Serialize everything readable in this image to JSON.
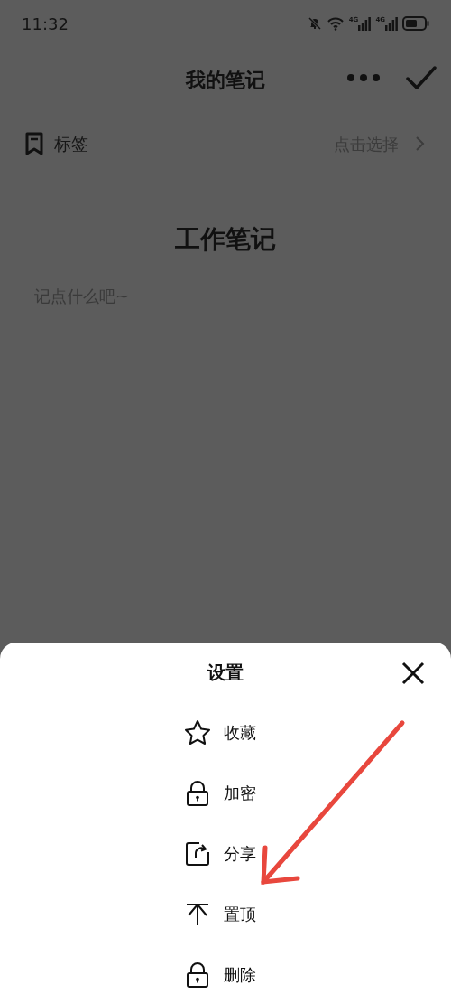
{
  "status_bar": {
    "time": "11:32",
    "networks": [
      "4G",
      "4G"
    ]
  },
  "header": {
    "title": "我的笔记"
  },
  "tag_row": {
    "label": "标签",
    "value": "点击选择"
  },
  "note": {
    "title": "工作笔记",
    "placeholder": "记点什么吧~"
  },
  "sheet": {
    "title": "设置",
    "items": [
      {
        "kind": "star",
        "label": "收藏"
      },
      {
        "kind": "lock",
        "label": "加密"
      },
      {
        "kind": "share",
        "label": "分享"
      },
      {
        "kind": "pin",
        "label": "置顶"
      },
      {
        "kind": "lock",
        "label": "删除"
      }
    ]
  },
  "annotations": [
    {
      "kind": "arrow"
    }
  ]
}
